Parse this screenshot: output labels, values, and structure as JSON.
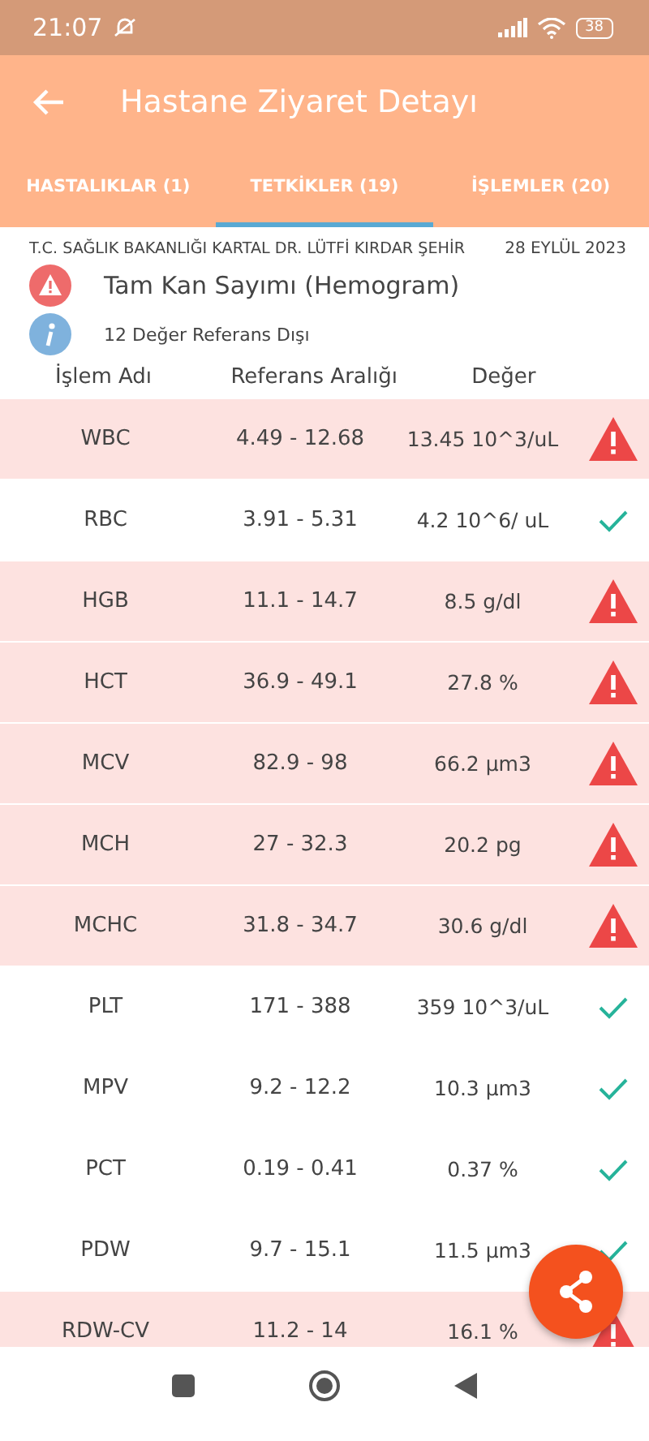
{
  "status_bar": {
    "time": "21:07",
    "battery": "38"
  },
  "toolbar": {
    "title": "Hastane Ziyaret Detayı"
  },
  "tabs": [
    {
      "label": "HASTALIKLAR (1)",
      "selected": false
    },
    {
      "label": "TETKİKLER (19)",
      "selected": true
    },
    {
      "label": "İŞLEMLER (20)",
      "selected": false
    }
  ],
  "visit": {
    "hospital": "T.C. SAĞLIK BAKANLIĞI KARTAL DR. LÜTFİ KIRDAR ŞEHİR",
    "date": "28 EYLÜL 2023",
    "test_name": "Tam Kan Sayımı (Hemogram)",
    "summary": "12 Değer Referans Dışı"
  },
  "table": {
    "columns": [
      "İşlem Adı",
      "Referans Aralığı",
      "Değer"
    ],
    "rows": [
      {
        "name": "WBC",
        "range": "4.49 - 12.68",
        "value": "13.45 10^3/uL",
        "out_of_range": true
      },
      {
        "name": "RBC",
        "range": "3.91 - 5.31",
        "value": "4.2 10^6/ uL",
        "out_of_range": false
      },
      {
        "name": "HGB",
        "range": "11.1 - 14.7",
        "value": "8.5 g/dl",
        "out_of_range": true
      },
      {
        "name": "HCT",
        "range": "36.9 - 49.1",
        "value": "27.8 %",
        "out_of_range": true
      },
      {
        "name": "MCV",
        "range": "82.9 - 98",
        "value": "66.2 µm3",
        "out_of_range": true
      },
      {
        "name": "MCH",
        "range": "27 - 32.3",
        "value": "20.2 pg",
        "out_of_range": true
      },
      {
        "name": "MCHC",
        "range": "31.8 - 34.7",
        "value": "30.6 g/dl",
        "out_of_range": true
      },
      {
        "name": "PLT",
        "range": "171 - 388",
        "value": "359 10^3/uL",
        "out_of_range": false
      },
      {
        "name": "MPV",
        "range": "9.2 - 12.2",
        "value": "10.3 µm3",
        "out_of_range": false
      },
      {
        "name": "PCT",
        "range": "0.19 - 0.41",
        "value": "0.37 %",
        "out_of_range": false
      },
      {
        "name": "PDW",
        "range": "9.7 - 15.1",
        "value": "11.5 µm3",
        "out_of_range": false
      },
      {
        "name": "RDW-CV",
        "range": "11.2 - 14",
        "value": "16.1 %",
        "out_of_range": true
      }
    ]
  }
}
